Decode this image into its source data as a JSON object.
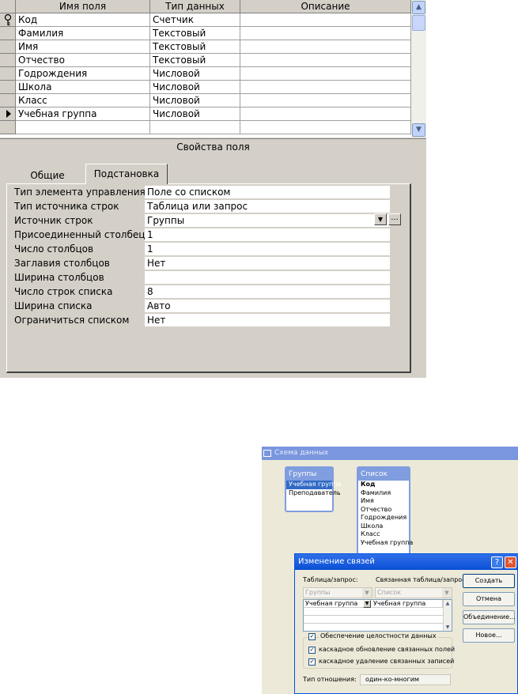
{
  "design": {
    "columns": [
      "Имя поля",
      "Тип данных",
      "Описание"
    ],
    "rows": [
      {
        "name": "Код",
        "type": "Счетчик",
        "desc": ""
      },
      {
        "name": "Фамилия",
        "type": "Текстовый",
        "desc": ""
      },
      {
        "name": "Имя",
        "type": "Текстовый",
        "desc": ""
      },
      {
        "name": "Отчество",
        "type": "Текстовый",
        "desc": ""
      },
      {
        "name": "Годрождения",
        "type": "Числовой",
        "desc": ""
      },
      {
        "name": "Школа",
        "type": "Числовой",
        "desc": ""
      },
      {
        "name": "Класс",
        "type": "Числовой",
        "desc": ""
      },
      {
        "name": "Учебная группа",
        "type": "Числовой",
        "desc": ""
      },
      {
        "name": "",
        "type": "",
        "desc": ""
      }
    ],
    "key_icon": "key-icon",
    "current_row_icon": "row-pointer-icon",
    "properties_title": "Свойства поля",
    "tabs": [
      "Общие",
      "Подстановка"
    ],
    "properties": [
      {
        "label": "Тип элемента управления",
        "value": "Поле со списком"
      },
      {
        "label": "Тип источника строк",
        "value": "Таблица или запрос"
      },
      {
        "label": "Источник строк",
        "value": "Группы"
      },
      {
        "label": "Присоединенный столбец",
        "value": "1"
      },
      {
        "label": "Число столбцов",
        "value": "1"
      },
      {
        "label": "Заглавия столбцов",
        "value": "Нет"
      },
      {
        "label": "Ширина столбцов",
        "value": ""
      },
      {
        "label": "Число строк списка",
        "value": "8"
      },
      {
        "label": "Ширина списка",
        "value": "Авто"
      },
      {
        "label": "Ограничиться списком",
        "value": "Нет"
      }
    ],
    "builder_label": "..."
  },
  "schema": {
    "title": "Схема данных",
    "tables": [
      {
        "name": "Группы",
        "fields": [
          "Учебная группа",
          "Преподаватель"
        ]
      },
      {
        "name": "Список",
        "fields": [
          "Код",
          "Фамилия",
          "Имя",
          "Отчество",
          "Годрождения",
          "Школа",
          "Класс",
          "Учебная группа"
        ]
      }
    ]
  },
  "dialog": {
    "title": "Изменение связей",
    "help": "?",
    "close": "✕",
    "table_label": "Таблица/запрос:",
    "related_label": "Связанная таблица/запрос:",
    "table_value": "Группы",
    "related_value": "Список",
    "field_left": "Учебная группа",
    "field_right": "Учебная группа",
    "buttons": [
      "Создать",
      "Отмена",
      "Объединение...",
      "Новое..."
    ],
    "integrity": "Обеспечение целостности данных",
    "cascade_update": "каскадное обновление связанных полей",
    "cascade_delete": "каскадное удаление связанных записей",
    "relation_label": "Тип отношения:",
    "relation_value": "один-ко-многим"
  }
}
